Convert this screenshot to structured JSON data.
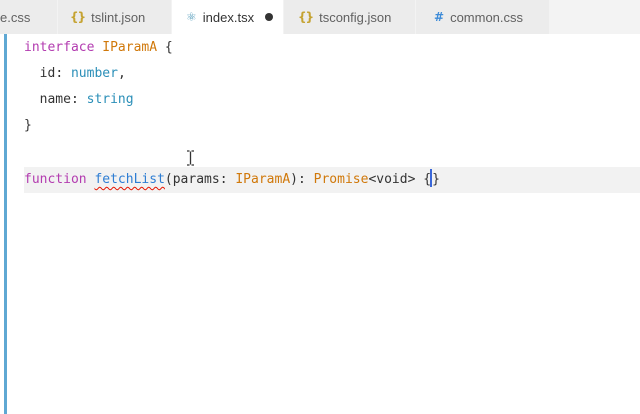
{
  "tabs": [
    {
      "label": "e.css",
      "icon": "css-hash-icon",
      "active": false
    },
    {
      "label": "tslint.json",
      "icon": "json-braces-icon",
      "active": false
    },
    {
      "label": "index.tsx",
      "icon": "react-atom-icon",
      "active": true,
      "modified": true
    },
    {
      "label": "tsconfig.json",
      "icon": "json-braces-icon",
      "active": false
    },
    {
      "label": "common.css",
      "icon": "css-hash-icon",
      "active": false
    }
  ],
  "icons": {
    "json": "{}",
    "react": "⚛",
    "css": "#"
  },
  "code": {
    "l1": {
      "kw": "interface",
      "name": "IParamA",
      "brace": " {"
    },
    "l2": {
      "prop": "id",
      "colon": ": ",
      "type": "number",
      "tail": ","
    },
    "l3": {
      "prop": "name",
      "colon": ": ",
      "type": "string"
    },
    "l4": {
      "close": "}"
    },
    "l6": {
      "kw": "function",
      "sp": " ",
      "fn": "fetchList",
      "open": "(",
      "param": "params",
      "colon": ": ",
      "ptype": "IParamA",
      "close": "): ",
      "ret": "Promise",
      "lt": "<",
      "void": "void",
      "gt": ">",
      "sp2": " ",
      "bo": "{",
      "bc": "}"
    }
  },
  "colors": {
    "keyword": "#b33cb0",
    "type": "#d0780a",
    "builtin": "#2b8fb8",
    "function": "#2e7dd3",
    "error": "#e51400",
    "gutter": "#5fa8d3",
    "cursor": "#3a67d8"
  }
}
